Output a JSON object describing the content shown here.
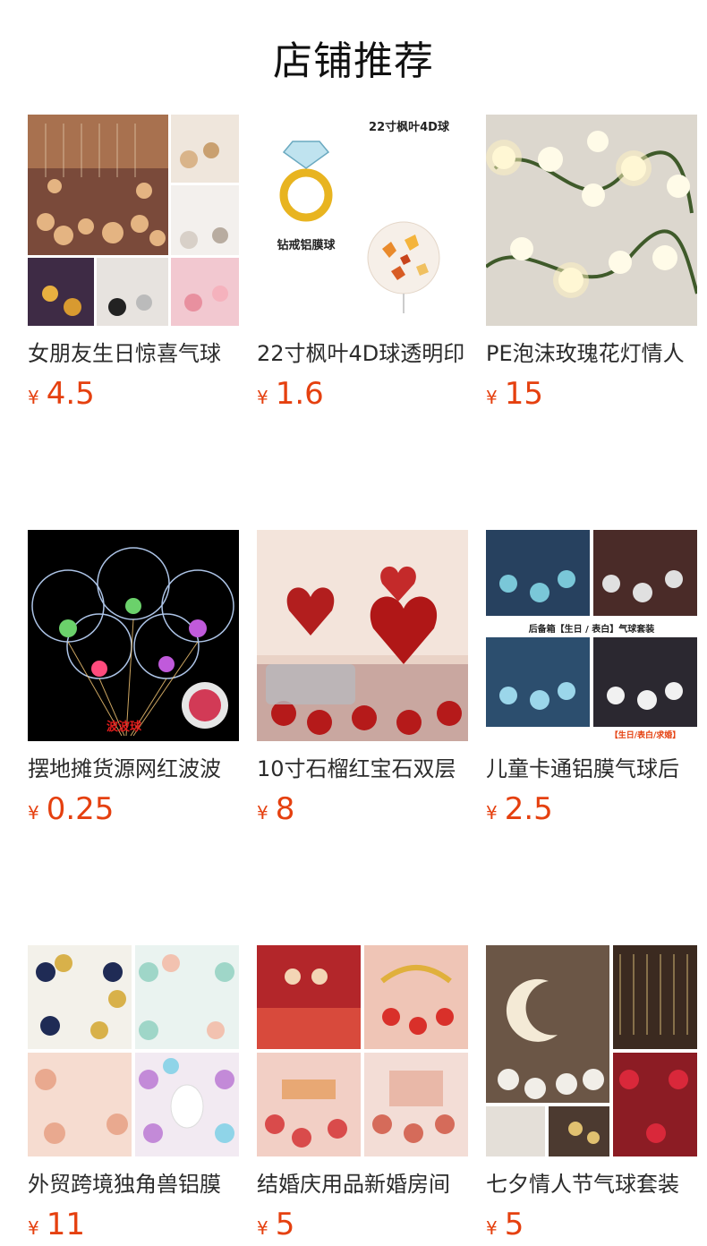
{
  "header": {
    "title": "店铺推荐"
  },
  "currency_symbol": "¥",
  "colors": {
    "price": "#e5400f",
    "title": "#2b2b2b"
  },
  "products": [
    {
      "title": "女朋友生日惊喜气球",
      "price": "4.5"
    },
    {
      "title": "22寸枫叶4D球透明印",
      "price": "1.6",
      "image_text": [
        "22寸枫叶4D球",
        "钻戒铝膜球"
      ]
    },
    {
      "title": "PE泡沫玫瑰花灯情人",
      "price": "15"
    },
    {
      "title": "摆地摊货源网红波波",
      "price": "0.25",
      "image_text": [
        "波波球"
      ]
    },
    {
      "title": "10寸石榴红宝石双层",
      "price": "8"
    },
    {
      "title": "儿童卡通铝膜气球后",
      "price": "2.5",
      "image_text": [
        "后备箱【生日 / 表白】气球套装",
        "【生日/表白/求婚】"
      ]
    },
    {
      "title": "外贸跨境独角兽铝膜",
      "price": "11"
    },
    {
      "title": "结婚庆用品新婚房间",
      "price": "5"
    },
    {
      "title": "七夕情人节气球套装",
      "price": "5"
    }
  ]
}
